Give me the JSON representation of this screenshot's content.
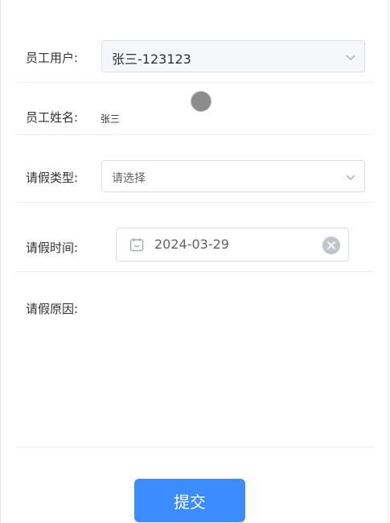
{
  "form": {
    "employee_user": {
      "label": "员工用户:",
      "value": "张三-123123"
    },
    "employee_name": {
      "label": "员工姓名:",
      "value": "张三"
    },
    "leave_type": {
      "label": "请假类型:",
      "placeholder": "请选择"
    },
    "leave_time": {
      "label": "请假时间:",
      "value": "2024-03-29"
    },
    "leave_reason": {
      "label": "请假原因:"
    }
  },
  "submit_label": "提交",
  "colors": {
    "primary": "#3b8cff",
    "border": "#dcdfe6",
    "divider": "#ebeef5"
  },
  "icons": [
    "chevron-down-icon",
    "calendar-icon",
    "clear-icon"
  ]
}
